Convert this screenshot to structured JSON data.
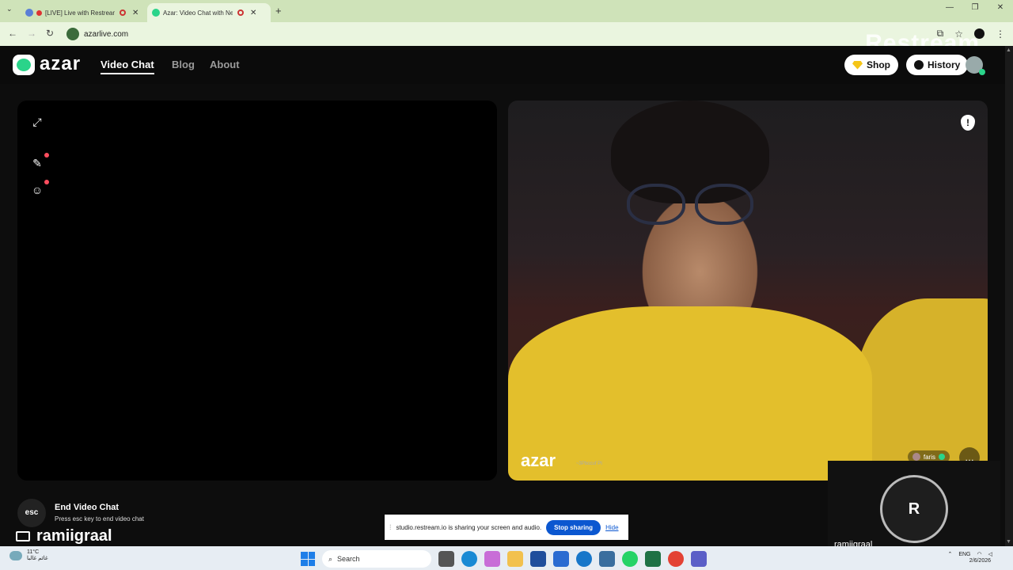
{
  "browser": {
    "tabs": [
      {
        "title": "[LIVE] Live with Restream"
      },
      {
        "title": "Azar: Video Chat with New"
      }
    ],
    "url": "azarlive.com",
    "watermark": "Restream"
  },
  "header": {
    "logo": "azar",
    "nav": [
      "Video Chat",
      "Blog",
      "About"
    ],
    "shop_label": "Shop",
    "history_label": "History"
  },
  "video": {
    "remote_logo": "azar",
    "remote_id": "~3Pbocuf PI",
    "peer_name": "faris",
    "report_icon": "!"
  },
  "bottom": {
    "esc_key": "esc",
    "end_title": "End Video Chat",
    "end_sub": "Press esc key to end video chat",
    "username": "ramiigraal"
  },
  "share_bar": {
    "message": "studio.restream.io is sharing your screen and audio.",
    "stop_label": "Stop sharing",
    "hide_label": "Hide"
  },
  "restream_tile": {
    "initial": "R",
    "name": "ramiigraal"
  },
  "taskbar": {
    "temperature": "11°C",
    "weather_text": "غائم غالبا",
    "search_placeholder": "Search",
    "lang": "ENG",
    "date": "2/6/2026"
  },
  "colors": {
    "accent_green": "#2ad48a",
    "stop_blue": "#0b57d0",
    "notify_red": "#ff4d5e"
  }
}
